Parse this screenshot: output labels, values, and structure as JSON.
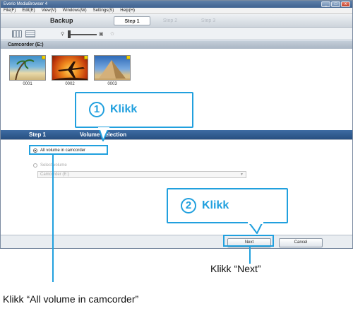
{
  "window": {
    "title": "Everio MediaBrowser 4",
    "controls": [
      "_",
      "□",
      "x"
    ]
  },
  "menu": [
    "File(F)",
    "Edit(E)",
    "View(V)",
    "Windows(W)",
    "Settings(S)",
    "Help(H)"
  ],
  "stepbar": {
    "title": "Backup",
    "steps": [
      "Step 1",
      "Step 2",
      "Step 3"
    ],
    "active_step": 0
  },
  "toolbar": {
    "icons": [
      "thumbnail-view-icon",
      "list-view-icon",
      "zoom-out-icon",
      "zoom-in-icon",
      "star-icon"
    ]
  },
  "source": {
    "label": "Camcorder (E:)",
    "items": [
      {
        "name": "0001",
        "icon": "beach-thumbnail"
      },
      {
        "name": "0002",
        "icon": "airplane-thumbnail"
      },
      {
        "name": "0003",
        "icon": "pyramid-thumbnail"
      }
    ]
  },
  "selection": {
    "step_label": "Step 1",
    "title": "Volume Selection",
    "all_label": "All volume in camcorder",
    "select_label": "Select volume",
    "select_value": "Camcorder (E:)"
  },
  "buttons": {
    "next": "Next",
    "cancel": "Cancel"
  },
  "callouts": {
    "one_num": "1",
    "one_text": "Klikk",
    "two_num": "2",
    "two_text": "Klikk"
  },
  "annotations": {
    "next": "Klikk “Next”",
    "all": "Klikk “All volume in camcorder”"
  },
  "colors": {
    "accent": "#21a0de",
    "header_dark": "#274f80"
  }
}
